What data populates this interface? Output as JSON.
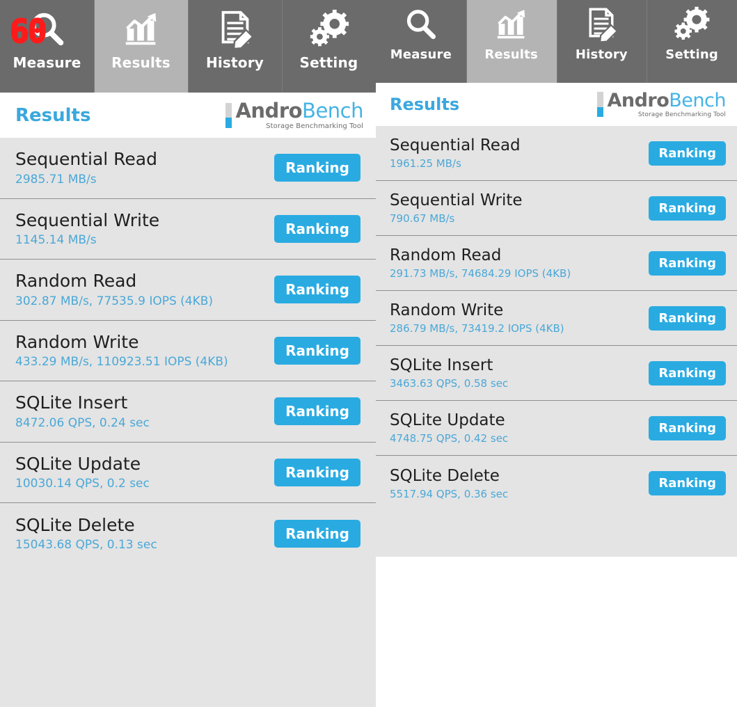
{
  "app": {
    "name": "AndroBench",
    "logo": {
      "word_first": "Andro",
      "word_second": "Bench",
      "tagline": "Storage Benchmarking Tool"
    },
    "accent_color": "#29abe2",
    "tab_selected_color": "#b4b4b4",
    "tab_color": "#6b6b6b",
    "list_bg_color": "#e4e4e4"
  },
  "overlay": {
    "fps_counter": "60",
    "fps_color": "#ff1a1a"
  },
  "tabs": [
    {
      "label": "Measure",
      "icon": "magnifier-icon",
      "selected": false
    },
    {
      "label": "Results",
      "icon": "bar-chart-icon",
      "selected": true
    },
    {
      "label": "History",
      "icon": "document-pencil-icon",
      "selected": false
    },
    {
      "label": "Setting",
      "icon": "gears-icon",
      "selected": false
    }
  ],
  "header": {
    "title": "Results"
  },
  "buttons": {
    "ranking_label": "Ranking"
  },
  "panels": [
    {
      "id": "left-device",
      "rows": [
        {
          "title": "Sequential Read",
          "value": "2985.71 MB/s"
        },
        {
          "title": "Sequential Write",
          "value": "1145.14 MB/s"
        },
        {
          "title": "Random Read",
          "value": "302.87 MB/s, 77535.9 IOPS (4KB)"
        },
        {
          "title": "Random Write",
          "value": "433.29 MB/s, 110923.51 IOPS (4KB)"
        },
        {
          "title": "SQLite Insert",
          "value": "8472.06 QPS, 0.24 sec"
        },
        {
          "title": "SQLite Update",
          "value": "10030.14 QPS, 0.2 sec"
        },
        {
          "title": "SQLite Delete",
          "value": "15043.68 QPS, 0.13 sec"
        }
      ]
    },
    {
      "id": "right-device",
      "rows": [
        {
          "title": "Sequential Read",
          "value": "1961.25 MB/s"
        },
        {
          "title": "Sequential Write",
          "value": "790.67 MB/s"
        },
        {
          "title": "Random Read",
          "value": "291.73 MB/s, 74684.29 IOPS (4KB)"
        },
        {
          "title": "Random Write",
          "value": "286.79 MB/s, 73419.2 IOPS (4KB)"
        },
        {
          "title": "SQLite Insert",
          "value": "3463.63 QPS, 0.58 sec"
        },
        {
          "title": "SQLite Update",
          "value": "4748.75 QPS, 0.42 sec"
        },
        {
          "title": "SQLite Delete",
          "value": "5517.94 QPS, 0.36 sec"
        }
      ]
    }
  ]
}
